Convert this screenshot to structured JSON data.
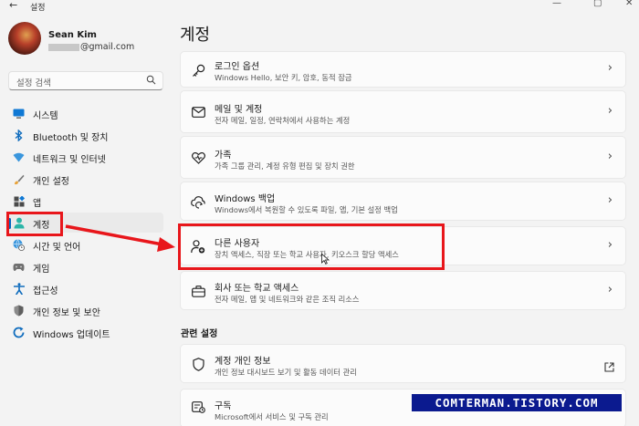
{
  "window": {
    "back_glyph": "←",
    "title": "설정",
    "controls": [
      "—",
      "▢",
      "✕"
    ]
  },
  "profile": {
    "name": "Sean Kim",
    "email_suffix": "@gmail.com"
  },
  "search": {
    "placeholder": "설정 검색",
    "icon": "search-icon"
  },
  "sidebar": {
    "items": [
      {
        "label": "시스템",
        "icon": "monitor-icon"
      },
      {
        "label": "Bluetooth 및 장치",
        "icon": "bluetooth-icon"
      },
      {
        "label": "네트워크 및 인터넷",
        "icon": "wifi-icon"
      },
      {
        "label": "개인 설정",
        "icon": "brush-icon"
      },
      {
        "label": "앱",
        "icon": "apps-icon"
      },
      {
        "label": "계정",
        "icon": "person-icon",
        "active": true
      },
      {
        "label": "시간 및 언어",
        "icon": "globe-clock-icon"
      },
      {
        "label": "게임",
        "icon": "gamepad-icon"
      },
      {
        "label": "접근성",
        "icon": "accessibility-icon"
      },
      {
        "label": "개인 정보 및 보안",
        "icon": "shield-icon"
      },
      {
        "label": "Windows 업데이트",
        "icon": "update-icon"
      }
    ]
  },
  "main": {
    "title": "계정",
    "cards": [
      {
        "title": "로그인 옵션",
        "desc": "Windows Hello, 보안 키, 암호, 동적 잠금",
        "icon": "key-icon"
      },
      {
        "title": "메일 및 계정",
        "desc": "전자 메일, 일정, 연락처에서 사용하는 계정",
        "icon": "mail-icon"
      },
      {
        "title": "가족",
        "desc": "가족 그룹 관리, 계정 유형 편집 및 장치 권한",
        "icon": "heart-icon"
      },
      {
        "title": "Windows 백업",
        "desc": "Windows에서 복원할 수 있도록 파일, 앱, 기본 설정 백업",
        "icon": "backup-icon"
      },
      {
        "title": "다른 사용자",
        "desc": "장치 액세스, 직장 또는 학교 사용자, 키오스크 할당 액세스",
        "icon": "add-user-icon"
      },
      {
        "title": "회사 또는 학교 액세스",
        "desc": "전자 메일, 앱 및 네트워크와 같은 조직 리소스",
        "icon": "briefcase-icon"
      }
    ],
    "related_title": "관련 설정",
    "related": [
      {
        "title": "계정 개인 정보",
        "desc": "개인 정보 대시보드 보기 및 활동 데이터 관리",
        "icon": "shield-icon"
      },
      {
        "title": "구독",
        "desc": "Microsoft에서 서비스 및 구독 관리",
        "icon": "subscription-icon"
      }
    ],
    "chevron": "›",
    "external_icon": "external-link-icon"
  },
  "annotations": {
    "highlight_color": "#e8161b"
  },
  "watermark": {
    "text": "COMTERMAN.TISTORY.COM"
  },
  "colors": {
    "accent": "#0067c0",
    "background": "#f3f3f3",
    "card": "#fbfbfb",
    "annotation_red": "#e8161b",
    "watermark_bg": "#0b1a8f"
  }
}
